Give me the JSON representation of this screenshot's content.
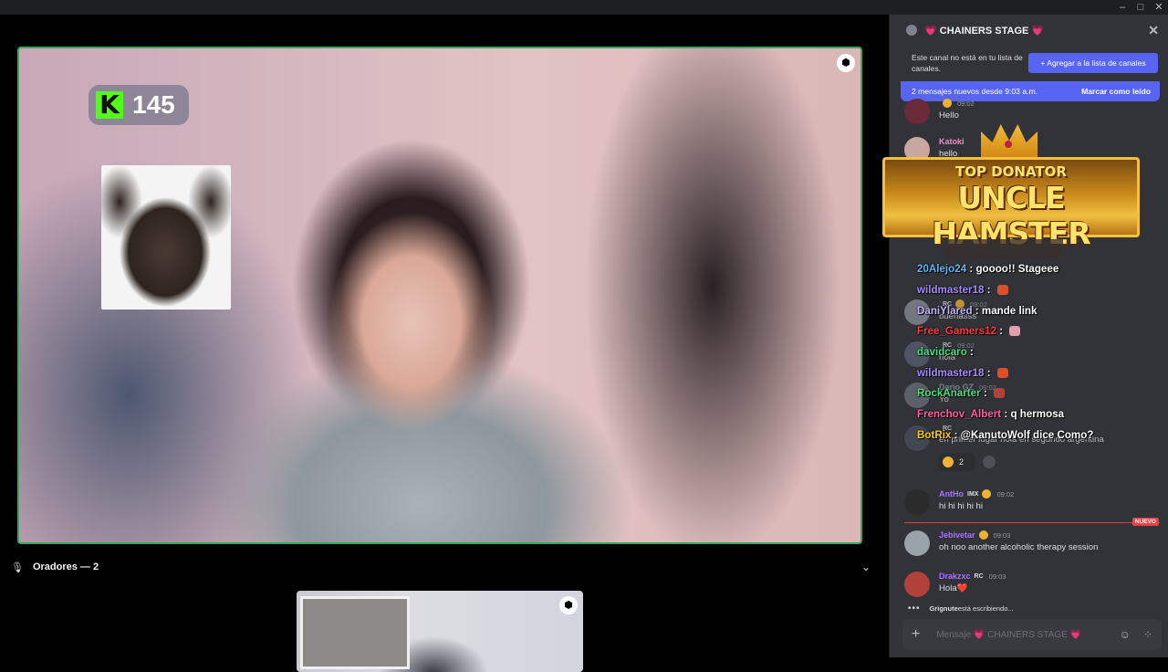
{
  "window": {
    "minimize": "–",
    "maximize": "□",
    "close": "✕"
  },
  "stage": {
    "kick_count": "145",
    "kick_logo": "K",
    "speakers_label": "Oradores — 2",
    "chevron": "⌄"
  },
  "chat": {
    "channel_title": "💗 CHAINERS STAGE 💗",
    "close": "✕",
    "notice_text": "Este canal no está en tu lista de canales.",
    "add_button": "+ Agregar a la lista de canales",
    "new_messages": "2 mensajes nuevos desde 9:03 a.m.",
    "mark_read": "Marcar como leído",
    "messages_top": [
      {
        "name": "",
        "time": "09:02",
        "text": "Hello",
        "name_color": "#949ba4",
        "avatar_color": "#6b2a3a"
      },
      {
        "name": "Katoki",
        "time": "",
        "text": "hello",
        "name_color": "#e891c8",
        "avatar_color": "#caa6a0"
      }
    ],
    "donator": {
      "top": "TOP DONATOR",
      "name": "UNCLE HAMSTER"
    },
    "overlay_chat": [
      {
        "user": "20Alejo24",
        "text": "goooo!! Stageee",
        "color": "#64b5f6"
      },
      {
        "user": "wildmaster18",
        "text": "",
        "color": "#a78bfa"
      },
      {
        "user": "DaniYlared",
        "text": "mande link",
        "color": "#c4b5fd"
      },
      {
        "user": "Free_Gamers12",
        "text": "",
        "color": "#ff3b3b"
      },
      {
        "user": "davidcaro",
        "text": "",
        "color": "#4ade80"
      },
      {
        "user": "wildmaster18",
        "text": "",
        "color": "#a78bfa"
      },
      {
        "user": "RockAnarter",
        "text": "",
        "color": "#4ade80"
      },
      {
        "user": "Frenchov_Albert",
        "text": "q hermosa",
        "color": "#ff5fa2"
      },
      {
        "user": "BotRix",
        "text": "@KanutoWolf dice Como?",
        "color": "#facc15"
      }
    ],
    "ghost_messages": [
      {
        "tag": "RC",
        "time": "09:02",
        "text": "buenasss"
      },
      {
        "tag": "RC",
        "time": "09:02",
        "text": "hola"
      },
      {
        "name": "Dario GZ",
        "tag": "",
        "time": "09:02",
        "text": "Yo"
      },
      {
        "tag": "RC",
        "time": "",
        "text": "en primer lugar hola en segundo argentina"
      }
    ],
    "reaction_count": "2",
    "messages_bottom": [
      {
        "name": "AntHo",
        "tag": "IMX",
        "time": "09:02",
        "text": "hi hi hi hi hi",
        "name_color": "#a970ff",
        "avatar_color": "#2b2b2b"
      },
      {
        "name": "Jebivetar",
        "tag": "",
        "time": "09:03",
        "text": "oh noo another alcoholic therapy session",
        "name_color": "#a970ff",
        "avatar_color": "#9aa3a8"
      },
      {
        "name": "Drakzxc",
        "tag": "RC",
        "time": "09:03",
        "text": "Hola❤️",
        "name_color": "#a970ff",
        "avatar_color": "#b0423a"
      }
    ],
    "new_label": "NUEVO",
    "typing_user": "Grignute",
    "typing_suffix": " está escribiendo...",
    "composer_placeholder": "Mensaje 💗 CHAINERS STAGE 💗"
  }
}
